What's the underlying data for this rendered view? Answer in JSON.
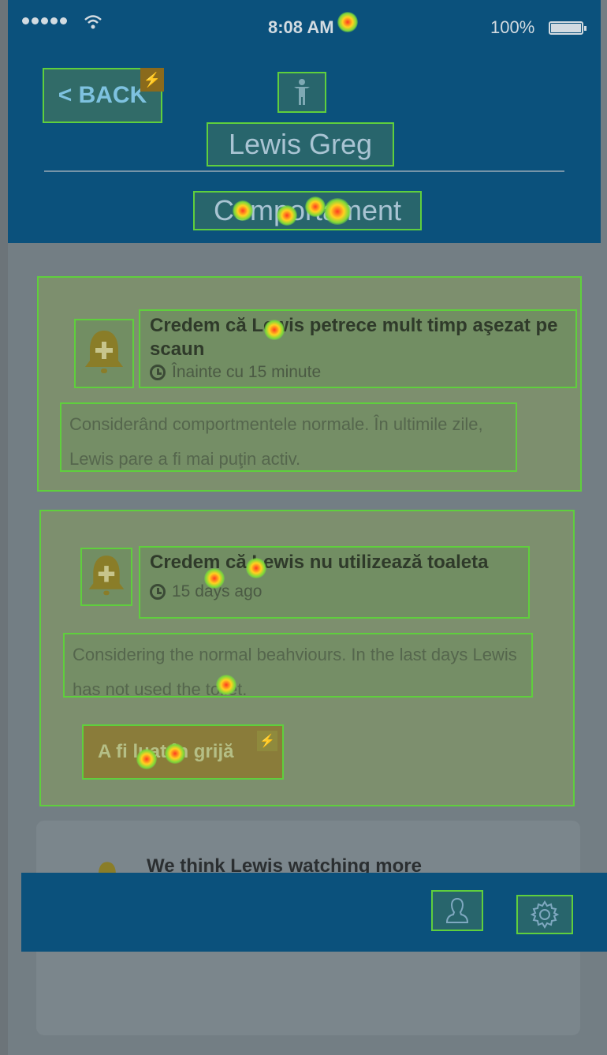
{
  "status_bar": {
    "time": "8:08 AM",
    "battery": "100%",
    "battery_level": 1.0
  },
  "header": {
    "back_label": "< BACK",
    "back_badge": "⚡",
    "person_icon": "child-icon",
    "name": "Lewis Greg",
    "section": "Comportament"
  },
  "cards": [
    {
      "icon": "bell-plus-icon",
      "title": "Credem că Lewis petrece mult timp aşezat pe scaun",
      "time": "Înainte cu 15 minute",
      "description": "Considerând comportmentele normale. În ultimile zile, Lewis pare a fi mai puţin activ."
    },
    {
      "icon": "bell-plus-icon",
      "title": "Credem că Lewis nu utilizează toaleta",
      "time": "15 days ago",
      "description": "Considering the normal beahviours. In the last days Lewis has not used the toilet.",
      "action_label": "A fi luat în grijă",
      "action_badge": "⚡"
    },
    {
      "icon": "bell-icon",
      "title": "We think Lewis watching more"
    }
  ],
  "tabbar": {
    "profile_icon": "user-icon",
    "settings_icon": "gear-icon"
  },
  "colors": {
    "header": "#0b517c",
    "highlight": "#5fcf3d"
  }
}
